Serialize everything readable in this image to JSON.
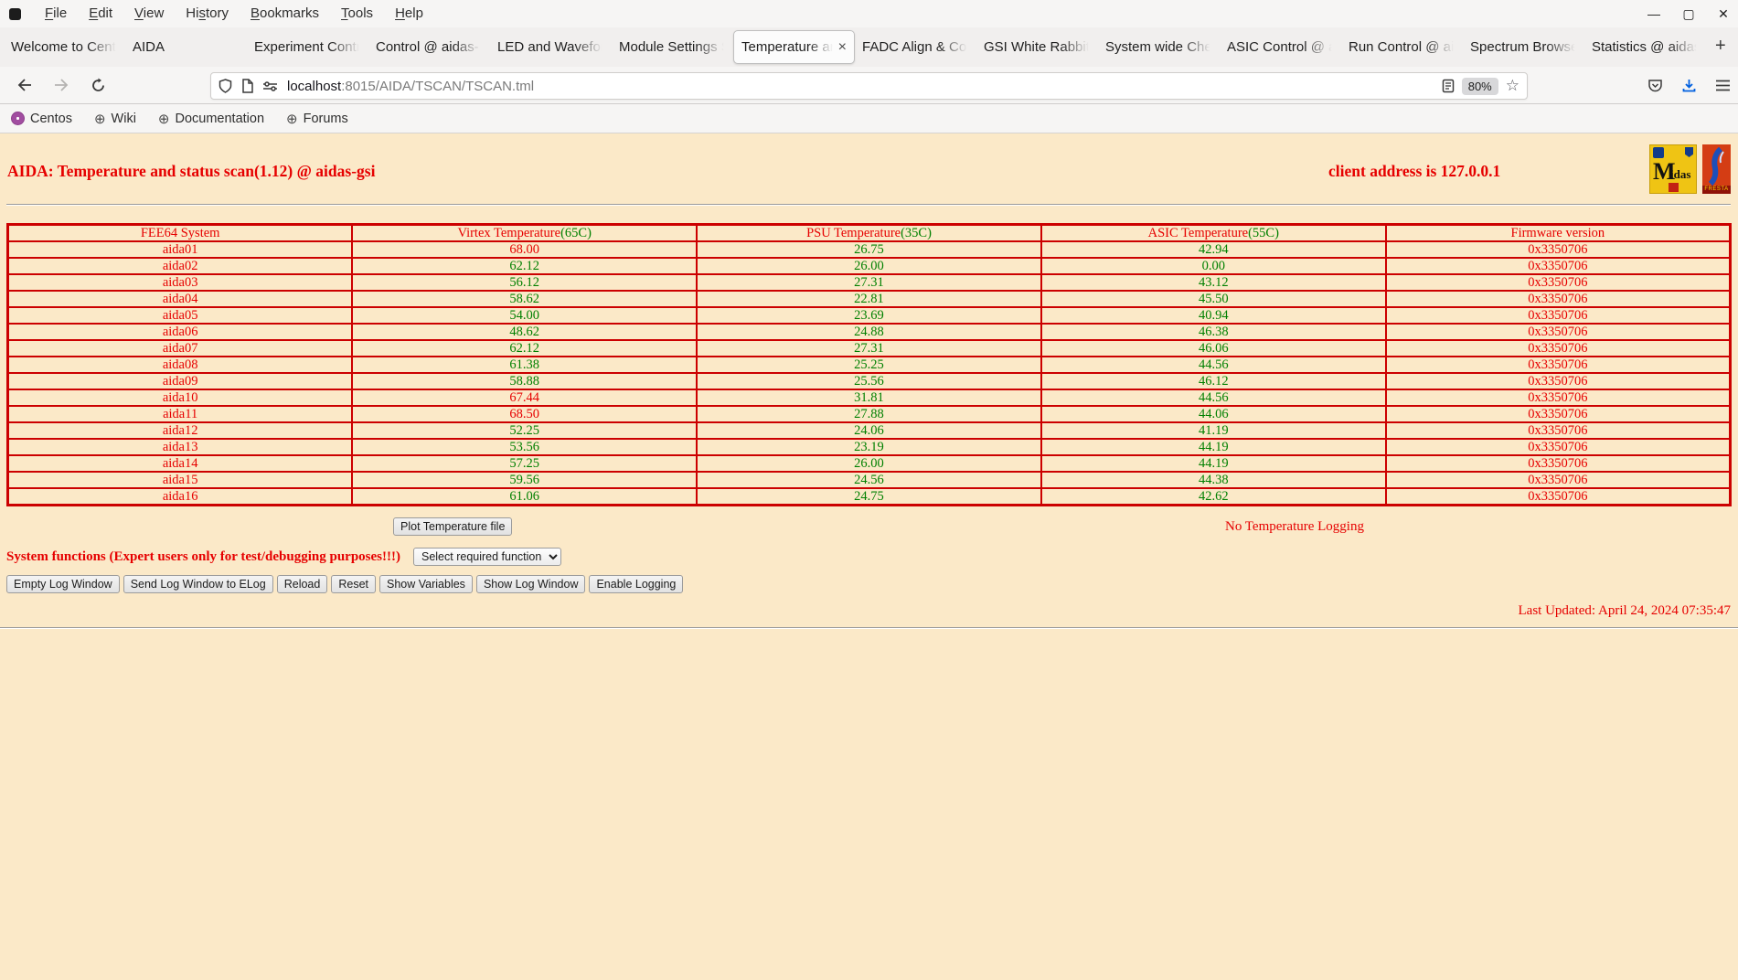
{
  "colors": {
    "page_bg": "#fbe9c8",
    "text_red": "#e60000",
    "text_green": "#008000",
    "table_border_red": "#cc0000",
    "download_blue": "#0060df",
    "chrome_bg": "#f6f5f4"
  },
  "browser": {
    "menu": [
      {
        "label": "File",
        "mnemonic": 0
      },
      {
        "label": "Edit",
        "mnemonic": 0
      },
      {
        "label": "View",
        "mnemonic": 0
      },
      {
        "label": "History",
        "mnemonic": 2
      },
      {
        "label": "Bookmarks",
        "mnemonic": 0
      },
      {
        "label": "Tools",
        "mnemonic": 0
      },
      {
        "label": "Help",
        "mnemonic": 0
      }
    ],
    "window_controls": {
      "minimize": "—",
      "maximize": "▢",
      "close": "✕"
    },
    "tabs": [
      {
        "label": "Welcome to Cent",
        "active": false
      },
      {
        "label": "AIDA",
        "active": false
      },
      {
        "label": "Experiment Contr",
        "active": false
      },
      {
        "label": "Control @ aidas-",
        "active": false
      },
      {
        "label": "LED and Wavefor",
        "active": false
      },
      {
        "label": "Module Settings S",
        "active": false
      },
      {
        "label": "Temperature an",
        "active": true,
        "close": "×"
      },
      {
        "label": "FADC Align & Co",
        "active": false
      },
      {
        "label": "GSI White Rabbit",
        "active": false
      },
      {
        "label": "System wide Che",
        "active": false
      },
      {
        "label": "ASIC Control @ a",
        "active": false
      },
      {
        "label": "Run Control @ ai",
        "active": false
      },
      {
        "label": "Spectrum Browse",
        "active": false
      },
      {
        "label": "Statistics @ aidas",
        "active": false
      }
    ],
    "new_tab_label": "+",
    "url": {
      "host": "localhost",
      "path": ":8015/AIDA/TSCAN/TSCAN.tml"
    },
    "zoom_badge": "80%",
    "star_glyph": "☆",
    "bookmarks": [
      {
        "label": "Centos",
        "icon": "centos"
      },
      {
        "label": "Wiki",
        "icon": "globe"
      },
      {
        "label": "Documentation",
        "icon": "globe"
      },
      {
        "label": "Forums",
        "icon": "globe"
      }
    ],
    "globe_glyph": "⊕"
  },
  "page": {
    "title": "AIDA: Temperature and status scan(1.12) @ aidas-gsi",
    "client_address": "client address is 127.0.0.1",
    "logos": {
      "midas_m": "M",
      "midas_rest": "idas",
      "fresta_strip": "FRESTA"
    },
    "plot_button_label": "Plot Temperature file",
    "logging_status": "No Temperature Logging",
    "system_functions_label": "System functions (Expert users only for test/debugging purposes!!!)",
    "select_value": "Select required function",
    "action_buttons": [
      "Empty Log Window",
      "Send Log Window to ELog",
      "Reload",
      "Reset",
      "Show Variables",
      "Show Log Window",
      "Enable Logging"
    ],
    "last_updated": "Last Updated: April 24, 2024 07:35:47"
  },
  "chart_data": {
    "type": "table",
    "title": "FEE64 temperature and status scan",
    "headers": [
      {
        "label": "FEE64 System",
        "threshold": ""
      },
      {
        "label": "Virtex Temperature",
        "threshold": "(65C)"
      },
      {
        "label": "PSU Temperature",
        "threshold": "(35C)"
      },
      {
        "label": "ASIC Temperature",
        "threshold": "(55C)"
      },
      {
        "label": "Firmware version",
        "threshold": ""
      }
    ],
    "rows": [
      {
        "name": "aida01",
        "virtex": "68.00",
        "virtex_alarm": true,
        "psu": "26.75",
        "asic": "42.94",
        "firmware": "0x3350706"
      },
      {
        "name": "aida02",
        "virtex": "62.12",
        "virtex_alarm": false,
        "psu": "26.00",
        "asic": "0.00",
        "firmware": "0x3350706"
      },
      {
        "name": "aida03",
        "virtex": "56.12",
        "virtex_alarm": false,
        "psu": "27.31",
        "asic": "43.12",
        "firmware": "0x3350706"
      },
      {
        "name": "aida04",
        "virtex": "58.62",
        "virtex_alarm": false,
        "psu": "22.81",
        "asic": "45.50",
        "firmware": "0x3350706"
      },
      {
        "name": "aida05",
        "virtex": "54.00",
        "virtex_alarm": false,
        "psu": "23.69",
        "asic": "40.94",
        "firmware": "0x3350706"
      },
      {
        "name": "aida06",
        "virtex": "48.62",
        "virtex_alarm": false,
        "psu": "24.88",
        "asic": "46.38",
        "firmware": "0x3350706"
      },
      {
        "name": "aida07",
        "virtex": "62.12",
        "virtex_alarm": false,
        "psu": "27.31",
        "asic": "46.06",
        "firmware": "0x3350706"
      },
      {
        "name": "aida08",
        "virtex": "61.38",
        "virtex_alarm": false,
        "psu": "25.25",
        "asic": "44.56",
        "firmware": "0x3350706"
      },
      {
        "name": "aida09",
        "virtex": "58.88",
        "virtex_alarm": false,
        "psu": "25.56",
        "asic": "46.12",
        "firmware": "0x3350706"
      },
      {
        "name": "aida10",
        "virtex": "67.44",
        "virtex_alarm": true,
        "psu": "31.81",
        "asic": "44.56",
        "firmware": "0x3350706"
      },
      {
        "name": "aida11",
        "virtex": "68.50",
        "virtex_alarm": true,
        "psu": "27.88",
        "asic": "44.06",
        "firmware": "0x3350706"
      },
      {
        "name": "aida12",
        "virtex": "52.25",
        "virtex_alarm": false,
        "psu": "24.06",
        "asic": "41.19",
        "firmware": "0x3350706"
      },
      {
        "name": "aida13",
        "virtex": "53.56",
        "virtex_alarm": false,
        "psu": "23.19",
        "asic": "44.19",
        "firmware": "0x3350706"
      },
      {
        "name": "aida14",
        "virtex": "57.25",
        "virtex_alarm": false,
        "psu": "26.00",
        "asic": "44.19",
        "firmware": "0x3350706"
      },
      {
        "name": "aida15",
        "virtex": "59.56",
        "virtex_alarm": false,
        "psu": "24.56",
        "asic": "44.38",
        "firmware": "0x3350706"
      },
      {
        "name": "aida16",
        "virtex": "61.06",
        "virtex_alarm": false,
        "psu": "24.75",
        "asic": "42.62",
        "firmware": "0x3350706"
      }
    ]
  }
}
